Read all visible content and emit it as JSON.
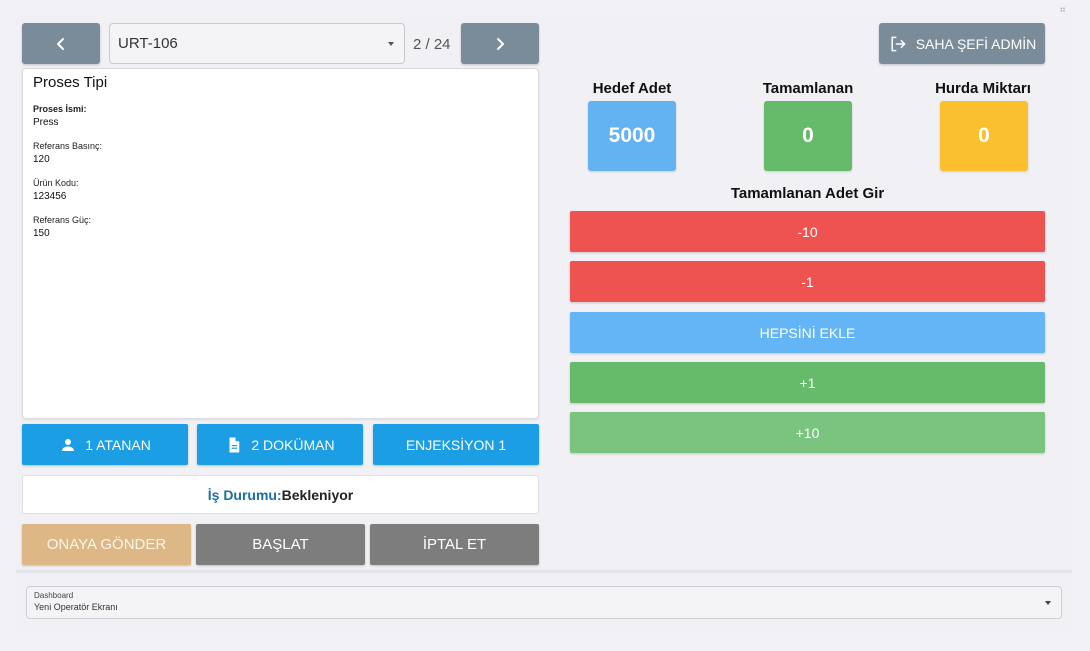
{
  "header": {
    "selected_order": "URT-106",
    "pager": "2 / 24",
    "admin_label": "SAHA ŞEFİ ADMİN"
  },
  "process_card": {
    "title": "Proses Tipi",
    "fields": [
      {
        "label": "Proses İsmi:",
        "value": "Press"
      },
      {
        "label": "Referans Basınç:",
        "value": "120"
      },
      {
        "label": "Ürün Kodu:",
        "value": "123456"
      },
      {
        "label": "Referans Güç:",
        "value": "150"
      }
    ]
  },
  "action_buttons": {
    "assigned": "1 ATANAN",
    "documents": "2 DOKÜMAN",
    "injection": "ENJEKSİYON 1"
  },
  "status": {
    "label": "İş Durumu:",
    "value": "Bekleniyor"
  },
  "bottom_buttons": {
    "submit": "ONAYA GÖNDER",
    "start": "BAŞLAT",
    "cancel": "İPTAL ET"
  },
  "stats": {
    "target": {
      "label": "Hedef Adet",
      "value": "5000",
      "color": "#63b2f2"
    },
    "completed": {
      "label": "Tamamlanan",
      "value": "0",
      "color": "#66bb6a"
    },
    "scrap": {
      "label": "Hurda Miktarı",
      "value": "0",
      "color": "#fbc02d"
    }
  },
  "entry": {
    "title": "Tamamlanan Adet Gir",
    "buttons": [
      {
        "label": "-10",
        "color": "#ef5350"
      },
      {
        "label": "-1",
        "color": "#ef5350"
      },
      {
        "label": "HEPSİNİ EKLE",
        "color": "#64b5f6"
      },
      {
        "label": "+1",
        "color": "#66bb6a"
      },
      {
        "label": "+10",
        "color": "#7bc47f"
      }
    ]
  },
  "dashboard": {
    "label": "Dashboard",
    "value": "Yeni Operatör Ekranı"
  },
  "colors": {
    "nav_gray": "#7a8c99",
    "primary_blue": "#1b9ee3",
    "submit_tan": "#ddb785",
    "neutral_gray": "#7d7d7d"
  }
}
